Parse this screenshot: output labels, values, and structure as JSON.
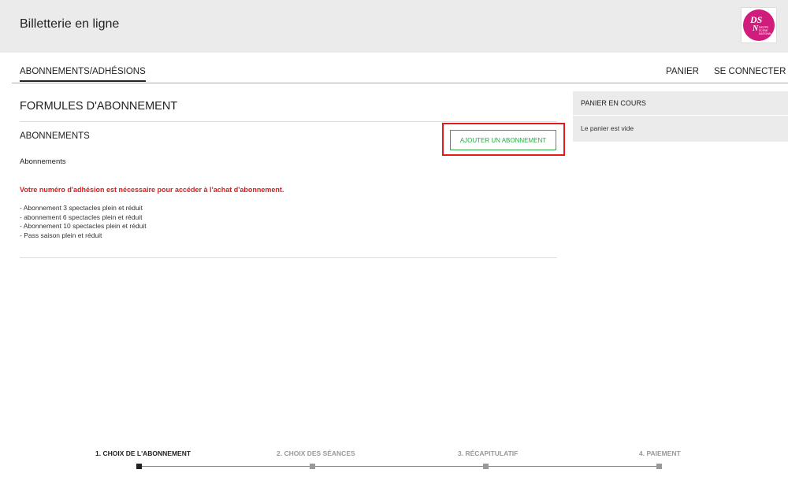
{
  "header": {
    "title": "Billetterie en ligne",
    "logo": {
      "icon": "dsn-logo",
      "lines": [
        "DS",
        "N",
        "DIEPPE",
        "SCÈNE",
        "NATIONALE"
      ],
      "color": "#d01c7c"
    }
  },
  "nav": {
    "tab_label": "ABONNEMENTS/ADHÉSIONS",
    "basket_label": "PANIER",
    "login_label": "SE CONNECTER"
  },
  "main": {
    "page_title": "FORMULES D'ABONNEMENT",
    "section_title": "ABONNEMENTS",
    "add_button_label": "AJOUTER UN ABONNEMENT",
    "section_subtitle": "Abonnements",
    "notice": "Votre numéro d'adhésion est nécessaire pour accéder à l'achat d'abonnement.",
    "offers": [
      "- Abonnement 3 spectacles plein et réduit",
      "- abonnement 6 spectacles plein et réduit",
      "- Abonnement 10 spectacles plein et réduit",
      "- Pass saison plein et réduit"
    ]
  },
  "cart": {
    "title": "PANIER EN COURS",
    "empty_text": "Le panier est vide"
  },
  "steps": [
    {
      "label": "1. CHOIX DE L'ABONNEMENT",
      "active": true
    },
    {
      "label": "2. CHOIX DES SÉANCES",
      "active": false
    },
    {
      "label": "3. RÉCAPITULATIF",
      "active": false
    },
    {
      "label": "4. PAIEMENT",
      "active": false
    }
  ],
  "colors": {
    "accent_green": "#2aa84a",
    "notice_red": "#e01b1b",
    "highlight_red": "#e01b1b",
    "brand_magenta": "#d01c7c"
  }
}
